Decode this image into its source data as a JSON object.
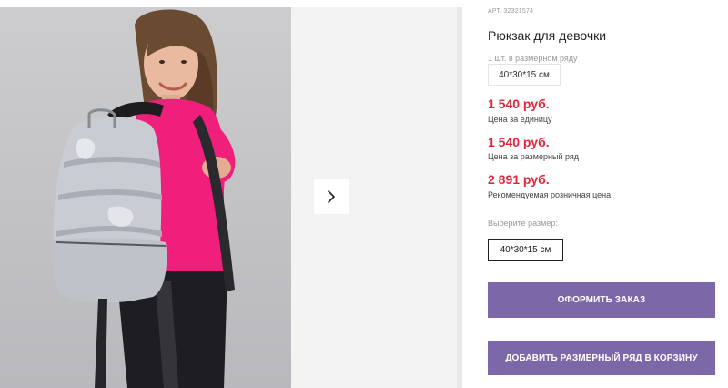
{
  "product": {
    "sku": "АРТ. 32321574",
    "title": "Рюкзак для девочки",
    "pack_note": "1 шт. в размерном ряду",
    "pack_size": "40*30*15 см"
  },
  "prices": [
    {
      "value": "1 540 руб.",
      "label": "Цена за единицу"
    },
    {
      "value": "1 540 руб.",
      "label": "Цена за размерный ряд"
    },
    {
      "value": "2 891 руб.",
      "label": "Рекомендуемая розничная цена"
    }
  ],
  "size_selector": {
    "label": "Выберите размер:",
    "options": [
      "40*30*15 см"
    ],
    "selected": "40*30*15 см"
  },
  "actions": {
    "order_label": "ОФОРМИТЬ ЗАКАЗ",
    "add_to_cart_label": "ДОБАВИТЬ РАЗМЕРНЫЙ РЯД В КОРЗИНУ"
  },
  "gallery": {
    "next_icon": "chevron-right-icon"
  },
  "colors": {
    "price": "#e4263b",
    "button": "#7c68a8",
    "jacket": "#ef1f7b",
    "backpack": "#c9ccd2"
  }
}
